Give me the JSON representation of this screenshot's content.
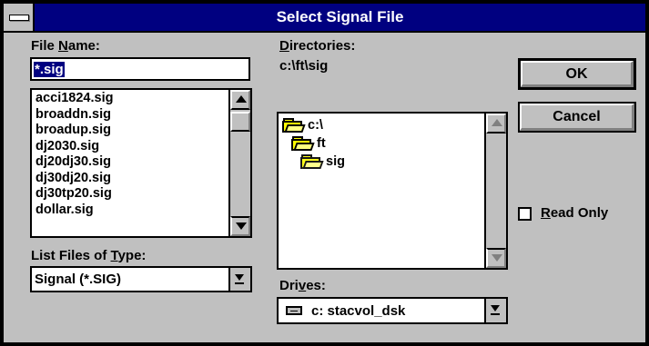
{
  "dialog": {
    "title": "Select Signal File"
  },
  "file_name": {
    "label_pre": "File ",
    "label_u": "N",
    "label_post": "ame:",
    "value": "*.sig"
  },
  "files": {
    "items": [
      "acci1824.sig",
      "broaddn.sig",
      "broadup.sig",
      "dj2030.sig",
      "dj20dj30.sig",
      "dj30dj20.sig",
      "dj30tp20.sig",
      "dollar.sig"
    ]
  },
  "directories": {
    "label_u": "D",
    "label_post": "irectories:",
    "current_path": "c:\\ft\\sig",
    "items": [
      "c:\\",
      "ft",
      "sig"
    ]
  },
  "file_type": {
    "label_pre": "List Files of ",
    "label_u": "T",
    "label_post": "ype:",
    "value": "Signal (*.SIG)"
  },
  "drives": {
    "label_pre": "Dri",
    "label_u": "v",
    "label_post": "es:",
    "value": "c: stacvol_dsk"
  },
  "buttons": {
    "ok": "OK",
    "cancel": "Cancel"
  },
  "read_only": {
    "label_u": "R",
    "label_post": "ead Only",
    "checked": false
  },
  "colors": {
    "titlebar": "#000080",
    "face": "#c0c0c0",
    "folder": "#ffff00"
  }
}
